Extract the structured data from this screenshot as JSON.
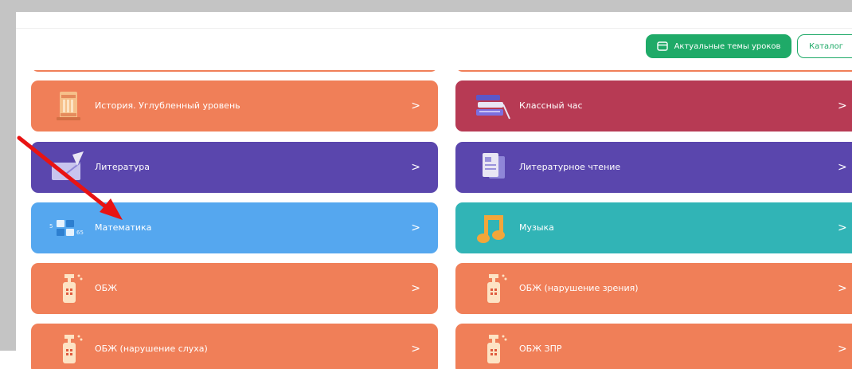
{
  "header": {
    "topics_button_label": "Актуальные темы уроков",
    "catalog_button_label": "Каталог"
  },
  "subjects": {
    "history_advanced": {
      "label": "История. Углубленный уровень",
      "chevron": ">"
    },
    "class_hour": {
      "label": "Классный час",
      "chevron": ">"
    },
    "literature": {
      "label": "Литература",
      "chevron": ">"
    },
    "literary_reading": {
      "label": "Литературное чтение",
      "chevron": ">"
    },
    "math": {
      "label": "Математика",
      "chevron": ">"
    },
    "music": {
      "label": "Музыка",
      "chevron": ">"
    },
    "obzh": {
      "label": "ОБЖ",
      "chevron": ">"
    },
    "obzh_vision": {
      "label": "ОБЖ (нарушение зрения)",
      "chevron": ">"
    },
    "obzh_hearing": {
      "label": "ОБЖ (нарушение слуха)",
      "chevron": ">"
    },
    "obzh_zpr": {
      "label": "ОБЖ ЗПР",
      "chevron": ">"
    }
  },
  "colors": {
    "green": "#1faa68",
    "orange": "#f07f58",
    "crimson": "#b73a54",
    "purple": "#5a46ad",
    "blue": "#55a7ef",
    "teal": "#31b4b6",
    "annotation_red": "#e81313"
  },
  "icons": {
    "topics": "calendar-icon",
    "history": "column-book-icon",
    "class_hour": "books-stack-icon",
    "literature": "quill-letter-icon",
    "literary_reading": "pages-icon",
    "math": "number-blocks-icon",
    "music": "music-note-icon",
    "obzh": "fire-extinguisher-icon"
  }
}
